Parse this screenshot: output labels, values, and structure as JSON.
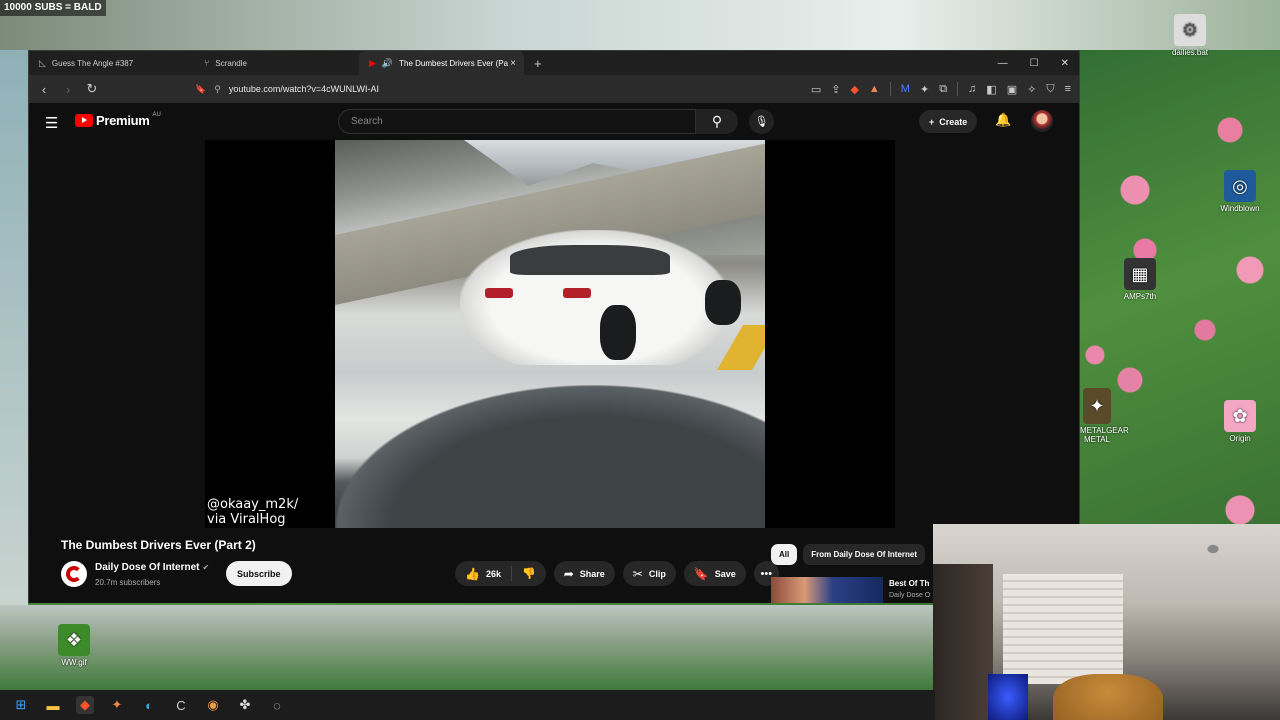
{
  "overlay": {
    "top_text": "10000 SUBS = BALD"
  },
  "desktop": {
    "icons": [
      {
        "label": "dailies.bat",
        "icon": "gear-icon"
      },
      {
        "label": "Windblown",
        "icon": "app-icon"
      },
      {
        "label": "AMPs7th",
        "icon": "file-icon"
      },
      {
        "label": "Origin",
        "icon": "game-icon"
      },
      {
        "label": "METALGEAR METAL",
        "icon": "game-icon"
      },
      {
        "label": "WW.gif",
        "icon": "image-icon"
      }
    ]
  },
  "browser": {
    "tabs": [
      {
        "label": "Guess The Angle #387",
        "icon": "angle-icon"
      },
      {
        "label": "Scrandle",
        "icon": "fork-icon"
      },
      {
        "label": "The Dumbest Drivers Ever (Pa",
        "icon": "youtube-icon"
      }
    ],
    "url": "youtube.com/watch?v=4cWUNLWI-AI"
  },
  "youtube": {
    "logo_text": "Premium",
    "region": "AU",
    "search_placeholder": "Search",
    "create_label": "Create",
    "video": {
      "watermark_line1": "@okaay_m2k/",
      "watermark_line2": "via ViralHog",
      "title": "The Dumbest Drivers Ever (Part 2)",
      "channel_name": "Daily Dose Of Internet",
      "subscribers": "20.7m subscribers",
      "subscribe_label": "Subscribe",
      "likes": "26k",
      "share_label": "Share",
      "clip_label": "Clip",
      "save_label": "Save"
    },
    "chips": [
      {
        "label": "All",
        "active": true
      },
      {
        "label": "From Daily Dose Of Internet",
        "active": false
      }
    ],
    "recommendation": {
      "title": "Best Of Th",
      "channel": "Daily Dose O"
    }
  },
  "taskbar": {
    "icons": [
      "windows-start-icon",
      "file-explorer-icon",
      "brave-icon",
      "app-icon",
      "edge-icon",
      "ccleaner-icon",
      "chrome-icon",
      "controller-icon",
      "obs-icon"
    ]
  }
}
